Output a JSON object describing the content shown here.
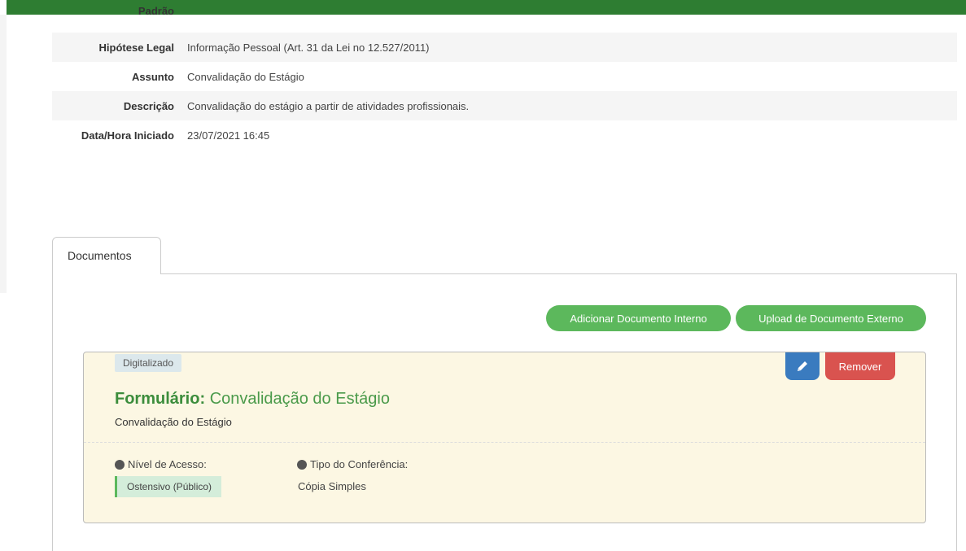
{
  "header": {
    "partial_label": "Padrão"
  },
  "details": [
    {
      "label": "Hipótese Legal",
      "value": "Informação Pessoal (Art. 31 da Lei no 12.527/2011)"
    },
    {
      "label": "Assunto",
      "value": "Convalidação do Estágio"
    },
    {
      "label": "Descrição",
      "value": "Convalidação do estágio a partir de atividades profissionais."
    },
    {
      "label": "Data/Hora Iniciado",
      "value": "23/07/2021 16:45"
    }
  ],
  "tabs": [
    {
      "label": "Documentos"
    }
  ],
  "actions": {
    "add_internal": "Adicionar Documento Interno",
    "upload_external": "Upload de Documento Externo"
  },
  "document": {
    "badge": "Digitalizado",
    "title_prefix": "Formulário:",
    "title_name": "Convalidação do Estágio",
    "subtitle": "Convalidação do Estágio",
    "edit_icon": "pencil-icon",
    "remove_label": "Remover",
    "access_label": "Nível de Acesso:",
    "access_value": "Ostensivo (Público)",
    "conference_label": "Tipo do Conferência:",
    "conference_value": "Cópia Simples"
  },
  "colors": {
    "topbar": "#2e7d32",
    "success": "#5cb85c",
    "primary": "#3a7bbf",
    "danger": "#d9534f",
    "card_bg": "#fcf7e3"
  }
}
